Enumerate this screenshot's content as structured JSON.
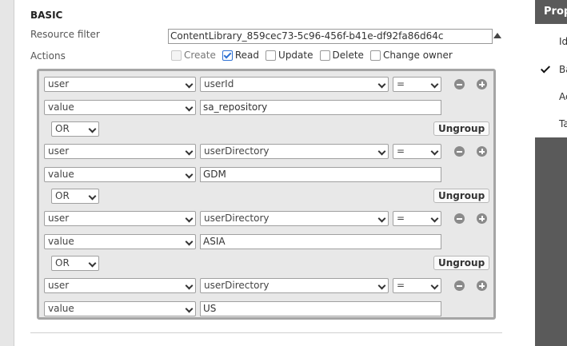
{
  "section": {
    "title": "BASIC"
  },
  "resource_filter": {
    "label": "Resource filter",
    "value": "ContentLibrary_859cec73-5c96-456f-b41e-df92fa86d64c"
  },
  "actions": {
    "label": "Actions",
    "items": [
      {
        "label": "Create",
        "checked": false,
        "disabled": true
      },
      {
        "label": "Read",
        "checked": true,
        "disabled": false
      },
      {
        "label": "Update",
        "checked": false,
        "disabled": false
      },
      {
        "label": "Delete",
        "checked": false,
        "disabled": false
      },
      {
        "label": "Change owner",
        "checked": false,
        "disabled": false
      }
    ]
  },
  "rules": [
    {
      "subject": "user",
      "property": "userId",
      "operator": "=",
      "value_type": "value",
      "value": "sa_repository",
      "connector": "OR",
      "ungroup_label": "Ungroup"
    },
    {
      "subject": "user",
      "property": "userDirectory",
      "operator": "=",
      "value_type": "value",
      "value": "GDM",
      "connector": "OR",
      "ungroup_label": "Ungroup"
    },
    {
      "subject": "user",
      "property": "userDirectory",
      "operator": "=",
      "value_type": "value",
      "value": "ASIA",
      "connector": "OR",
      "ungroup_label": "Ungroup"
    },
    {
      "subject": "user",
      "property": "userDirectory",
      "operator": "=",
      "value_type": "value",
      "value": "US"
    }
  ],
  "right_panel": {
    "header": "Prop",
    "items": [
      "Id",
      "Ba",
      "Ac",
      "Ta"
    ],
    "checked_index": 1
  }
}
